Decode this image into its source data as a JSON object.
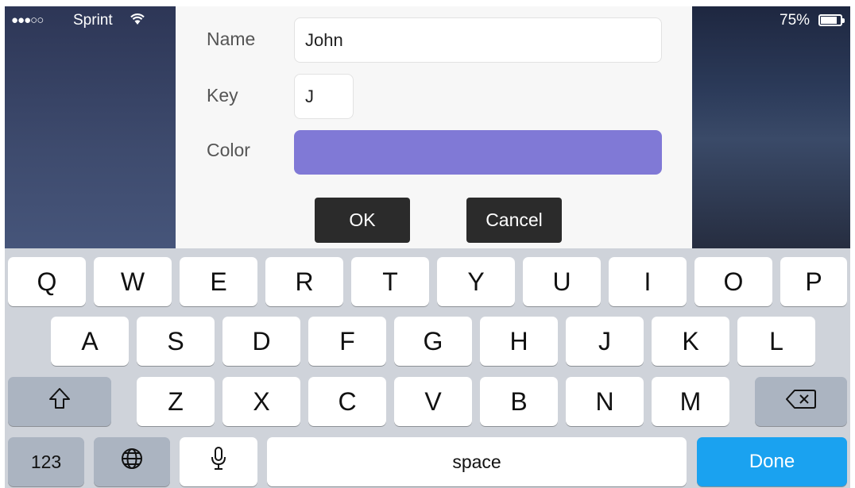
{
  "status": {
    "signal": "●●●○○",
    "carrier": "Sprint",
    "battery": "75%"
  },
  "dialog": {
    "name_label": "Name",
    "name_value": "John",
    "key_label": "Key",
    "key_value": "J",
    "color_label": "Color",
    "color_value": "#8079d6",
    "ok_label": "OK",
    "cancel_label": "Cancel"
  },
  "keyboard": {
    "row1": [
      "Q",
      "W",
      "E",
      "R",
      "T",
      "Y",
      "U",
      "I",
      "O",
      "P"
    ],
    "row2": [
      "A",
      "S",
      "D",
      "F",
      "G",
      "H",
      "J",
      "K",
      "L"
    ],
    "row3": [
      "Z",
      "X",
      "C",
      "V",
      "B",
      "N",
      "M"
    ],
    "numbers_label": "123",
    "space_label": "space",
    "done_label": "Done"
  }
}
